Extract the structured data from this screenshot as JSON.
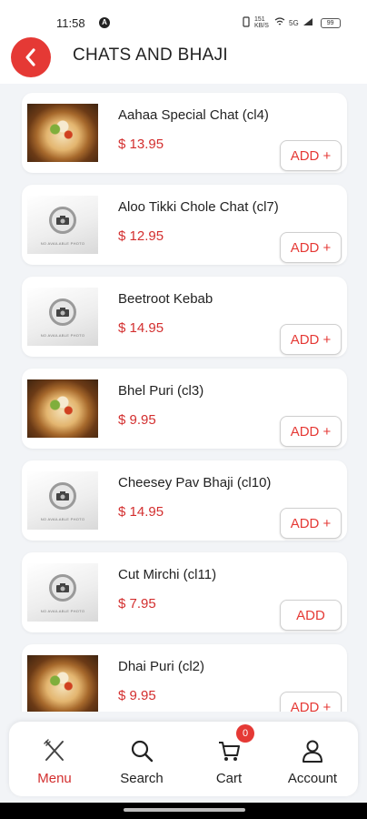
{
  "status_bar": {
    "time": "11:58",
    "indicator": "A",
    "icons": [
      "vibrate-icon",
      "data-speed-icon",
      "wifi-icon",
      "signal-icon"
    ],
    "speed": "151 KB/S",
    "signal": "5G",
    "battery": "99"
  },
  "header": {
    "title": "CHATS AND BHAJI",
    "back_icon": "chevron-left-icon",
    "accent": "#e53935"
  },
  "items": [
    {
      "name": "Aahaa Special Chat (cl4)",
      "price": "$ 13.95",
      "button": "ADD +",
      "image": "food-photo"
    },
    {
      "name": "Aloo Tikki Chole Chat (cl7)",
      "price": "$ 12.95",
      "button": "ADD +",
      "image": "no-photo"
    },
    {
      "name": "Beetroot Kebab",
      "price": "$ 14.95",
      "button": "ADD +",
      "image": "no-photo"
    },
    {
      "name": "Bhel Puri (cl3)",
      "price": "$ 9.95",
      "button": "ADD +",
      "image": "food-photo"
    },
    {
      "name": "Cheesey Pav Bhaji (cl10)",
      "price": "$ 14.95",
      "button": "ADD +",
      "image": "no-photo"
    },
    {
      "name": "Cut Mirchi (cl11)",
      "price": "$ 7.95",
      "button": "ADD",
      "image": "no-photo"
    },
    {
      "name": "Dhai Puri (cl2)",
      "price": "$ 9.95",
      "button": "ADD +",
      "image": "food-photo"
    }
  ],
  "no_photo_text": "NO AVAILABLE PHOTO",
  "bottom_nav": {
    "menu": "Menu",
    "search": "Search",
    "cart": "Cart",
    "cart_count": "0",
    "account": "Account",
    "active": "Menu",
    "active_color": "#d32f2f"
  }
}
